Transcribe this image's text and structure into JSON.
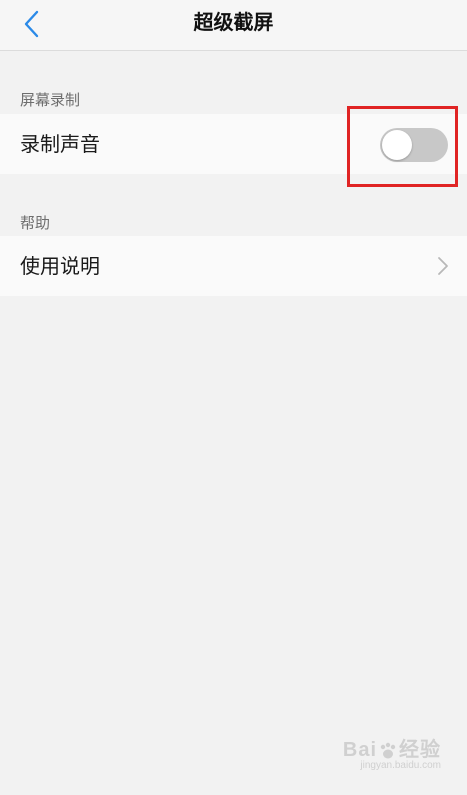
{
  "header": {
    "title": "超级截屏",
    "back_icon": "chevron-left-icon",
    "accent_color": "#2b8ae8"
  },
  "sections": [
    {
      "label": "屏幕录制",
      "rows": [
        {
          "label": "录制声音",
          "control": "toggle",
          "toggle_on": false
        }
      ]
    },
    {
      "label": "帮助",
      "rows": [
        {
          "label": "使用说明",
          "control": "chevron-right-icon"
        }
      ]
    }
  ],
  "annotation": {
    "highlight_color": "#e02424"
  },
  "watermark": {
    "brand_prefix": "Bai",
    "brand_suffix": "经验",
    "url": "jingyan.baidu.com"
  }
}
